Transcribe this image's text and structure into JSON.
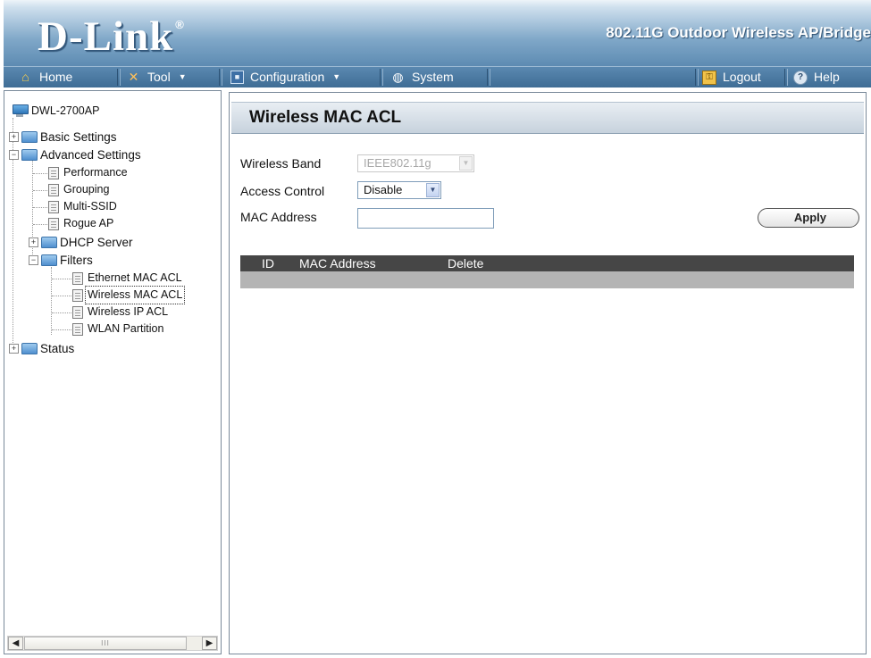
{
  "header": {
    "logo": "D-Link",
    "logo_mark": "®",
    "product_name": "802.11G Outdoor Wireless AP/Bridge"
  },
  "menubar": {
    "home": "Home",
    "tool": "Tool",
    "configuration": "Configuration",
    "system": "System",
    "logout": "Logout",
    "help": "Help"
  },
  "tree": {
    "root": "DWL-2700AP",
    "basic_settings": "Basic Settings",
    "advanced_settings": "Advanced Settings",
    "performance": "Performance",
    "grouping": "Grouping",
    "multi_ssid": "Multi-SSID",
    "rogue_ap": "Rogue AP",
    "dhcp_server": "DHCP Server",
    "filters": "Filters",
    "ethernet_mac_acl": "Ethernet MAC ACL",
    "wireless_mac_acl": "Wireless MAC ACL",
    "wireless_ip_acl": "Wireless IP ACL",
    "wlan_partition": "WLAN Partition",
    "status": "Status",
    "scroll_grip": "III"
  },
  "main": {
    "title": "Wireless MAC ACL",
    "wireless_band_label": "Wireless Band",
    "wireless_band_value": "IEEE802.11g",
    "access_control_label": "Access Control",
    "access_control_value": "Disable",
    "mac_address_label": "MAC Address",
    "mac_address_value": "",
    "apply_label": "Apply",
    "table": {
      "col_id": "ID",
      "col_mac": "MAC Address",
      "col_delete": "Delete"
    }
  }
}
